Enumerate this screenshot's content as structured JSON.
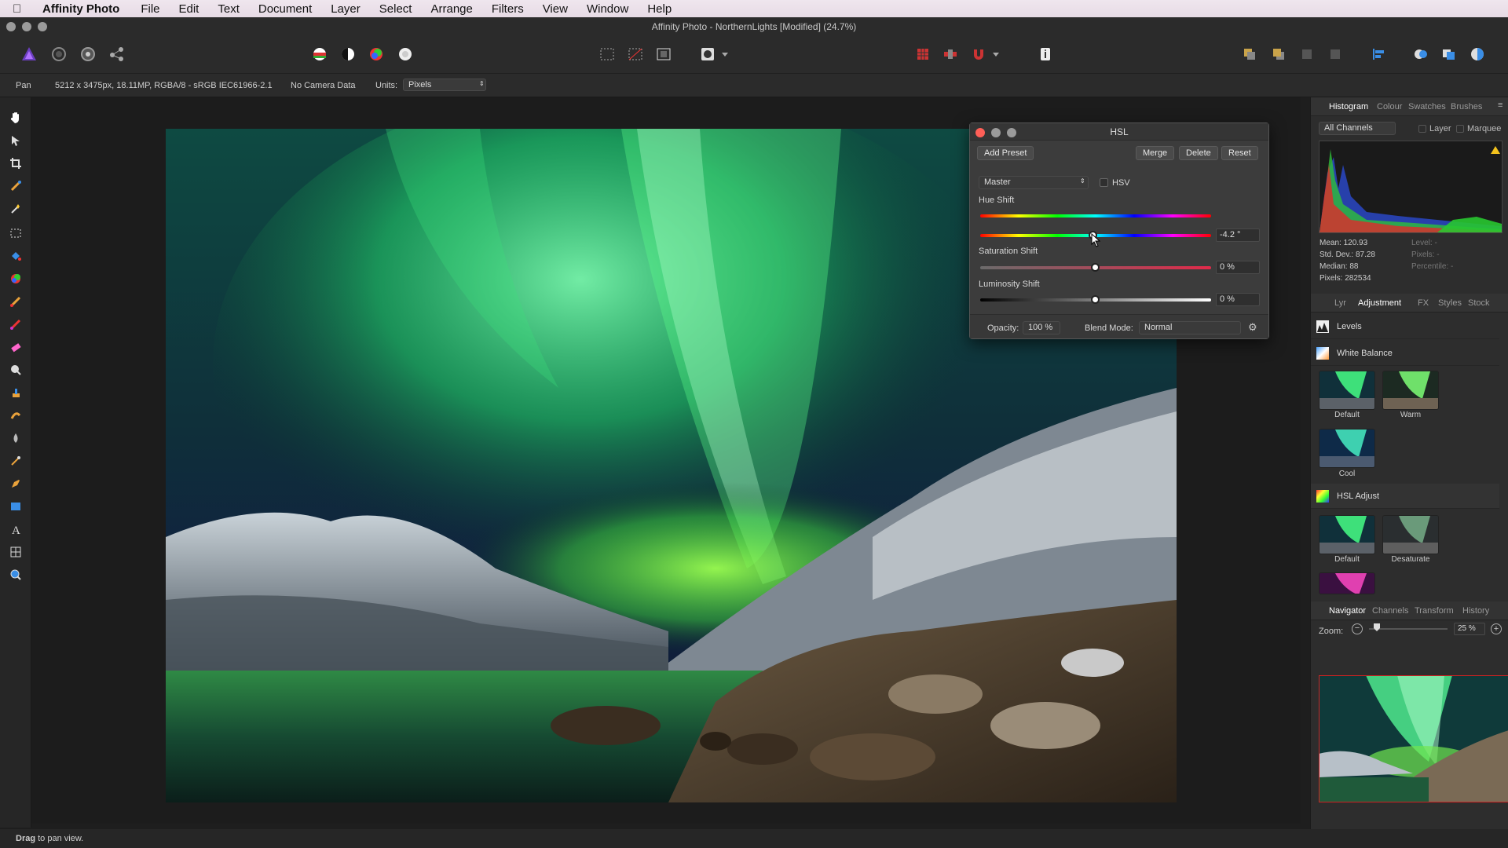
{
  "menubar": {
    "app": "Affinity Photo",
    "items": [
      "File",
      "Edit",
      "Text",
      "Document",
      "Layer",
      "Select",
      "Arrange",
      "Filters",
      "View",
      "Window",
      "Help"
    ]
  },
  "window": {
    "title": "Affinity Photo - NorthernLights [Modified] (24.7%)"
  },
  "context": {
    "tool": "Pan",
    "info": "5212 x 3475px, 18.11MP, RGBA/8 - sRGB IEC61966-2.1",
    "camera": "No Camera Data",
    "units_label": "Units:",
    "units_value": "Pixels"
  },
  "hsl": {
    "title": "HSL",
    "add_preset": "Add Preset",
    "merge": "Merge",
    "delete": "Delete",
    "reset": "Reset",
    "channel": "Master",
    "hsv_label": "HSV",
    "hue_label": "Hue Shift",
    "hue_value": "-4.2 °",
    "sat_label": "Saturation Shift",
    "sat_value": "0 %",
    "lum_label": "Luminosity Shift",
    "lum_value": "0 %",
    "opacity_label": "Opacity:",
    "opacity_value": "100 %",
    "blend_label": "Blend Mode:",
    "blend_value": "Normal"
  },
  "histogram": {
    "tabs": [
      "Histogram",
      "Colour",
      "Swatches",
      "Brushes"
    ],
    "channels": "All Channels",
    "layer_label": "Layer",
    "marquee_label": "Marquee",
    "stats": {
      "mean": "Mean: 120.93",
      "std": "Std. Dev.: 87.28",
      "median": "Median: 88",
      "pixels": "Pixels: 282534",
      "level": "Level: -",
      "pixels2": "Pixels: -",
      "percentile": "Percentile: -"
    }
  },
  "adjustments": {
    "tabs": [
      "Lyr",
      "Adjustment",
      "FX",
      "Styles",
      "Stock"
    ],
    "levels": "Levels",
    "white_balance": "White Balance",
    "wb_presets": [
      "Default",
      "Warm",
      "Cool"
    ],
    "hsl_adjust": "HSL Adjust",
    "hsl_presets": [
      "Default",
      "Desaturate"
    ]
  },
  "navigator": {
    "tabs": [
      "Navigator",
      "Channels",
      "Transform",
      "History"
    ],
    "zoom_label": "Zoom:",
    "zoom_value": "25 %"
  },
  "status": {
    "bold": "Drag",
    "text": " to pan view."
  },
  "colors": {
    "accent": "#2d8cff",
    "close": "#ff5f57"
  }
}
